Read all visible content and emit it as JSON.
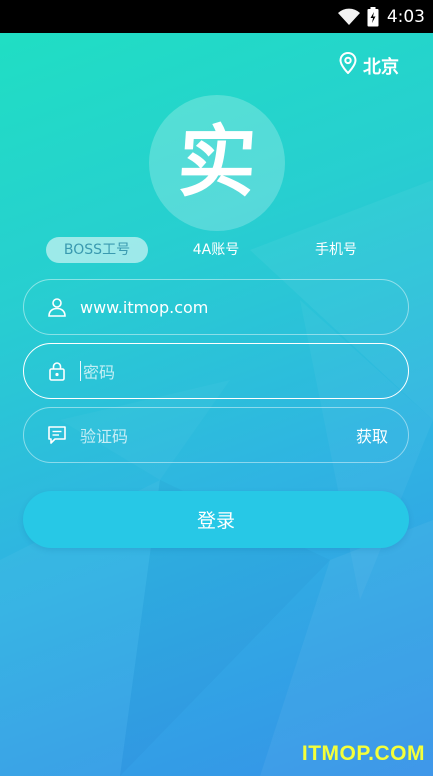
{
  "status_bar": {
    "time": "4:03",
    "icons": [
      "wifi-icon",
      "battery-icon"
    ]
  },
  "location": {
    "icon": "location-pin-icon",
    "city": "北京"
  },
  "logo": {
    "char": "实"
  },
  "tabs": [
    {
      "label": "BOSS工号",
      "active": true
    },
    {
      "label": "4A账号",
      "active": false
    },
    {
      "label": "手机号",
      "active": false
    }
  ],
  "form": {
    "username": {
      "icon": "user-icon",
      "value": "www.itmop.com"
    },
    "password": {
      "icon": "lock-icon",
      "placeholder": "密码"
    },
    "captcha": {
      "icon": "message-icon",
      "placeholder": "验证码",
      "action_label": "获取"
    }
  },
  "login_button": {
    "label": "登录"
  },
  "watermark": {
    "text": "ITMOP.COM"
  }
}
